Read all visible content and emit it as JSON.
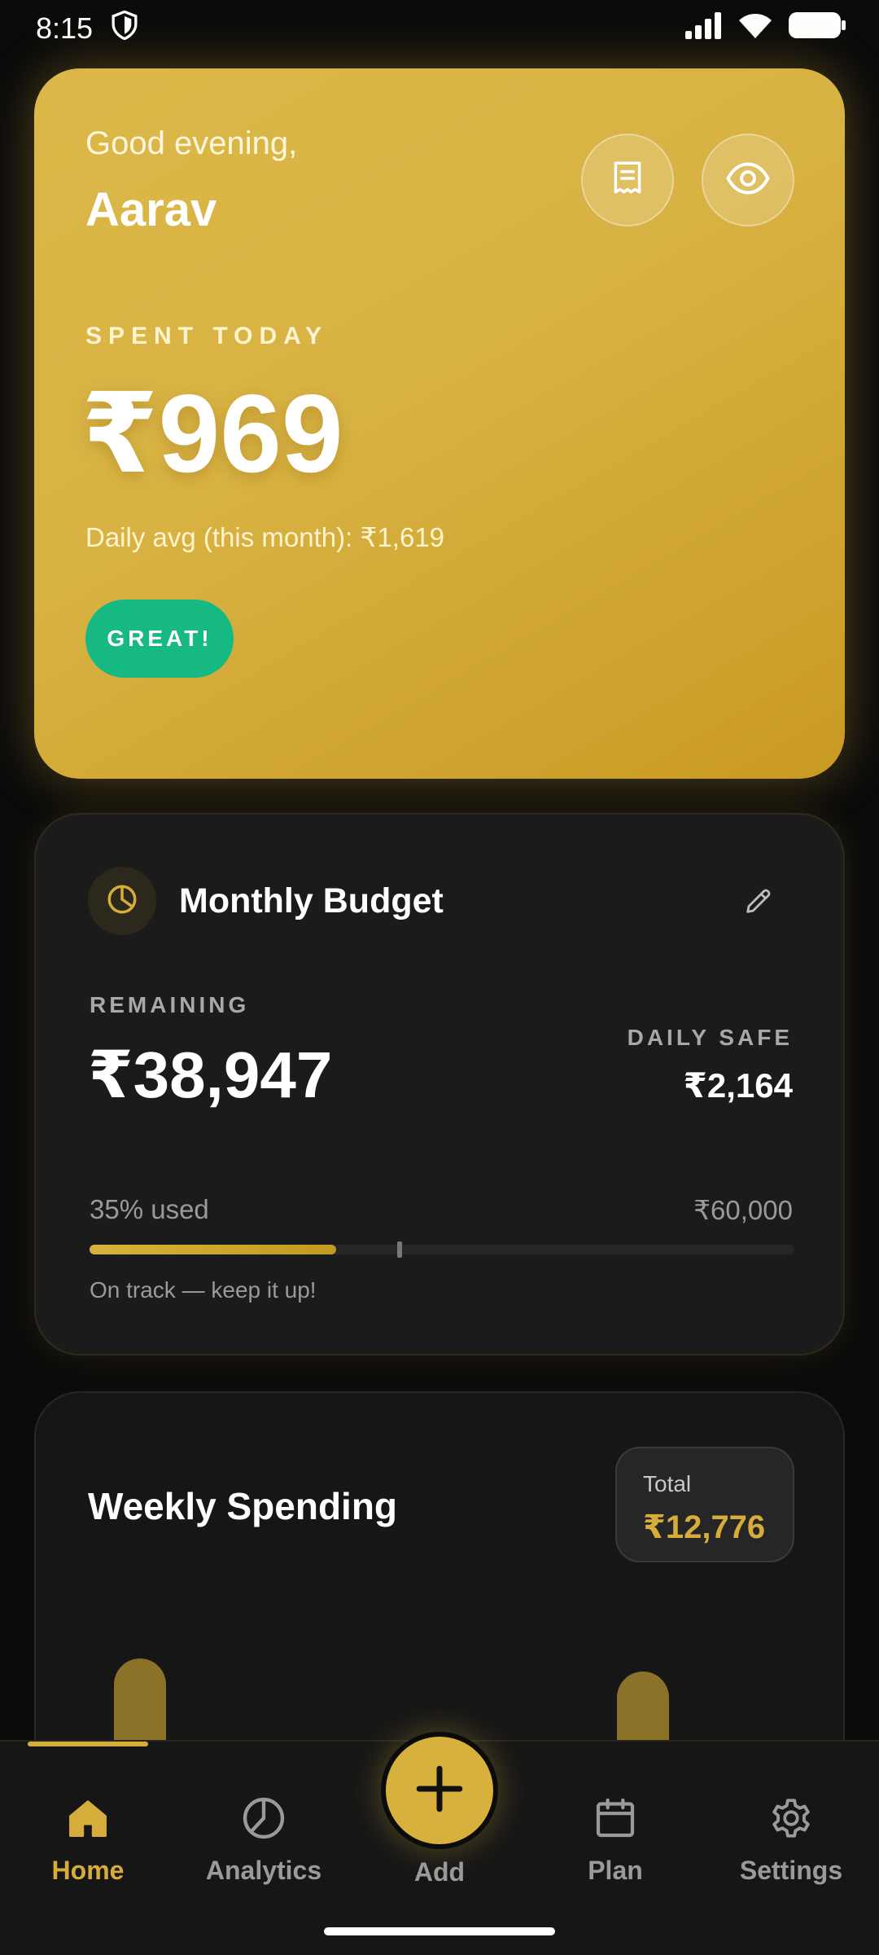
{
  "status_bar": {
    "time": "8:15",
    "icons": [
      "shield-icon",
      "signal-icon",
      "wifi-icon",
      "battery-icon"
    ]
  },
  "hero": {
    "greeting": "Good evening,",
    "user_name": "Aarav",
    "spent_label": "SPENT TODAY",
    "spent_amount": "₹969",
    "daily_avg": "Daily avg (this month): ₹1,619",
    "badge": "GREAT!",
    "actions": [
      "receipt-icon",
      "eye-icon"
    ],
    "colors": {
      "gold": "#d8b242",
      "badge_green": "#17b983"
    }
  },
  "budget": {
    "title": "Monthly Budget",
    "remaining_label": "REMAINING",
    "remaining_amount": "₹38,947",
    "daily_safe_label": "DAILY SAFE",
    "daily_safe_amount": "₹2,164",
    "used_text": "35% used",
    "total": "₹60,000",
    "used_fraction": 0.35,
    "expected_fraction": 0.44,
    "note": "On track — keep it up!"
  },
  "weekly": {
    "title": "Weekly Spending",
    "total_label": "Total",
    "total_amount": "₹12,776"
  },
  "nav": {
    "home": "Home",
    "analytics": "Analytics",
    "add": "Add",
    "plan": "Plan",
    "settings": "Settings",
    "active": "home",
    "accent": "#d6ad3a"
  }
}
